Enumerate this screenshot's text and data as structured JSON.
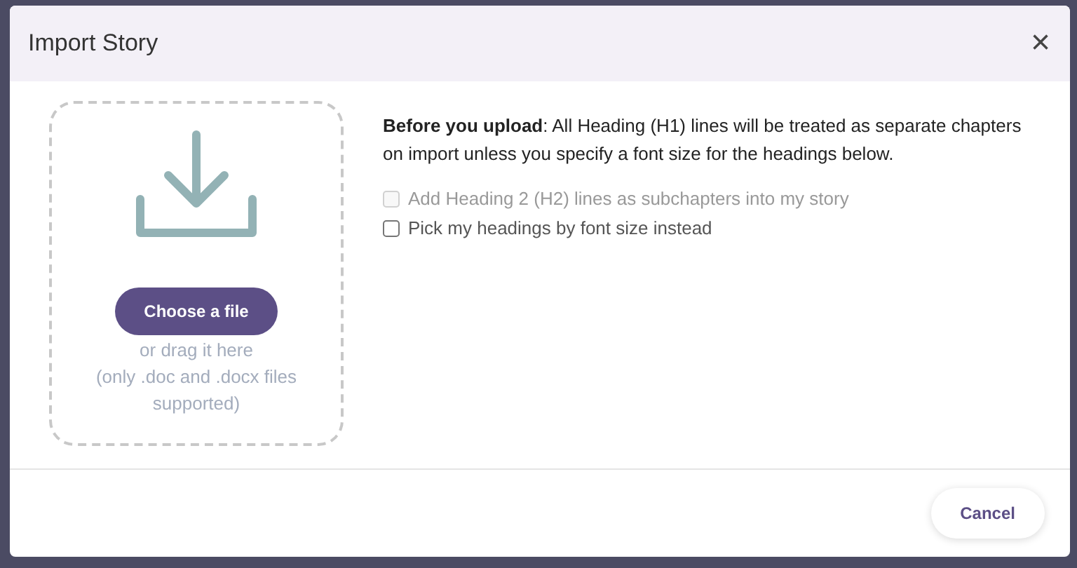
{
  "dialog": {
    "title": "Import Story",
    "close": "×"
  },
  "dropzone": {
    "button": "Choose a file",
    "hint": "or drag it here",
    "note": "(only .doc and .docx files supported)"
  },
  "notice": "**Before you upload**: All Heading (H1) lines will be treated as separate chapters on import unless you specify a font size for the headings below.",
  "options": [
    {
      "label": "Add Heading 2 (H2) lines as subchapters into my story",
      "checked": false,
      "disabled": true
    },
    {
      "label": "Pick my headings by font size instead",
      "checked": false,
      "disabled": false
    }
  ],
  "buttons": [
    "Cancel"
  ]
}
